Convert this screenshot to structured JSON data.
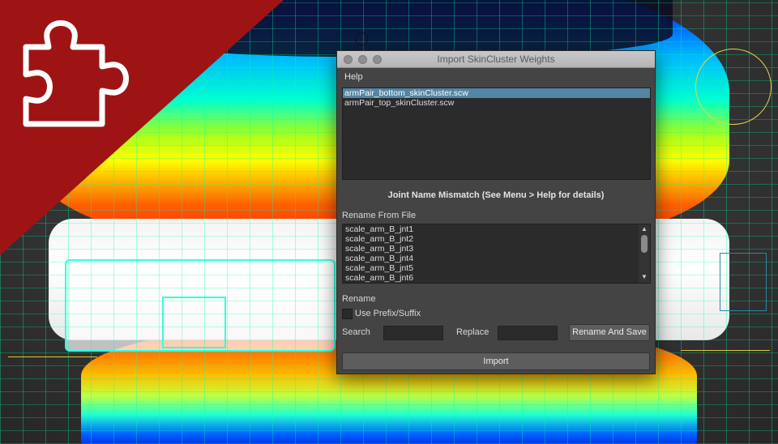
{
  "dialog": {
    "title": "Import SkinCluster Weights",
    "menu_help": "Help",
    "files": [
      "armPair_bottom_skinCluster.scw",
      "armPair_top_skinCluster.scw"
    ],
    "selected_file_index": 0,
    "mismatch_message": "Joint Name Mismatch (See Menu > Help for details)",
    "rename_from_file_label": "Rename From File",
    "joints": [
      "scale_arm_B_jnt1",
      "scale_arm_B_jnt2",
      "scale_arm_B_jnt3",
      "scale_arm_B_jnt4",
      "scale_arm_B_jnt5",
      "scale_arm_B_jnt6"
    ],
    "rename_label": "Rename",
    "use_prefix_suffix_label": "Use Prefix/Suffix",
    "use_prefix_suffix_checked": false,
    "search_label": "Search",
    "search_value": "",
    "replace_label": "Replace",
    "replace_value": "",
    "rename_and_save_label": "Rename And Save",
    "import_label": "Import"
  },
  "badge": {
    "icon": "puzzle-piece-icon",
    "color": "#9e1414"
  }
}
